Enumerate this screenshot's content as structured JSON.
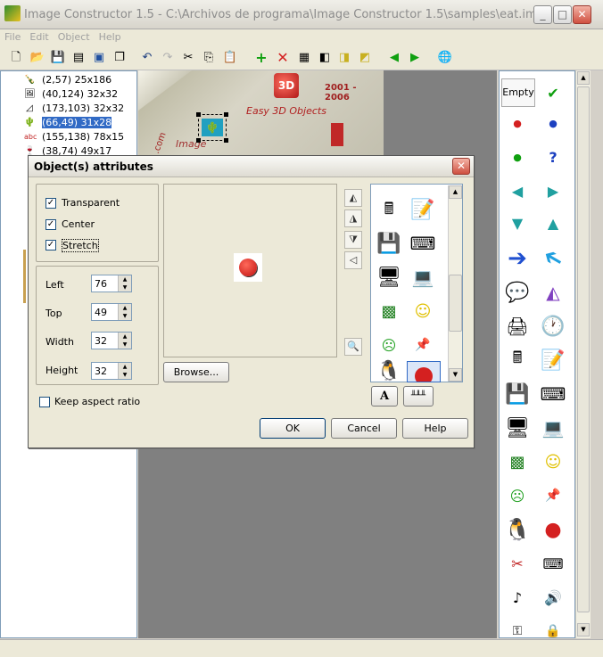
{
  "window": {
    "title": "Image Constructor 1.5 - C:\\Archivos de programa\\Image Constructor 1.5\\samples\\eat.img"
  },
  "menu": [
    "File",
    "Edit",
    "Object",
    "Help"
  ],
  "tree": [
    {
      "label": "(2,57) 25x186",
      "icon": "bottle-icon"
    },
    {
      "label": "(40,124) 32x32",
      "icon": "painting-icon"
    },
    {
      "label": "(173,103) 32x32",
      "icon": "triangle-icon"
    },
    {
      "label": "(66,49) 31x28",
      "icon": "cactus-icon",
      "selected": true
    },
    {
      "label": "(155,138) 78x15",
      "icon": "text-icon"
    },
    {
      "label": "(38,74) 49x17",
      "icon": "glass-icon"
    }
  ],
  "canvas": {
    "years": "2001 - 2006",
    "caption": "Easy 3D Objects",
    "image_label": "Image",
    "com_label": ".com"
  },
  "right_panel": {
    "empty_label": "Empty"
  },
  "dialog": {
    "title": "Object(s) attributes",
    "options": [
      {
        "label": "Transparent",
        "checked": true
      },
      {
        "label": "Center",
        "checked": true
      },
      {
        "label": "Stretch",
        "checked": true
      }
    ],
    "fields": [
      {
        "label": "Left",
        "value": "76"
      },
      {
        "label": "Top",
        "value": "49"
      },
      {
        "label": "Width",
        "value": "32"
      },
      {
        "label": "Height",
        "value": "32"
      }
    ],
    "browse_label": "Browse...",
    "keep_aspect_label": "Keep aspect ratio",
    "keep_aspect_checked": false,
    "ok_label": "OK",
    "cancel_label": "Cancel",
    "help_label": "Help",
    "font_button_label": "A"
  },
  "colors": {
    "selection": "#316ac5",
    "accent_red": "#d42020",
    "canvas_bg": "#808080"
  }
}
